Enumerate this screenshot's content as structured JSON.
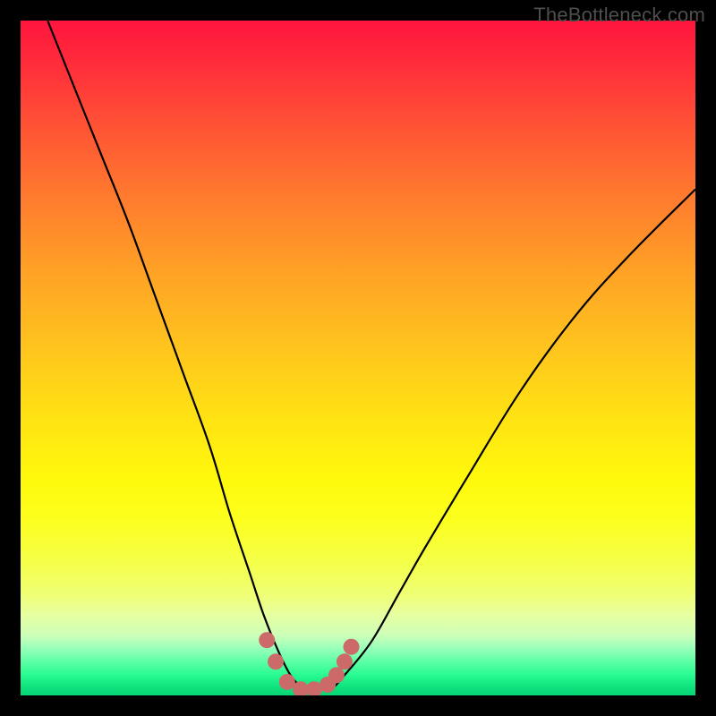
{
  "watermark": "TheBottleneck.com",
  "chart_data": {
    "type": "line",
    "title": "",
    "xlabel": "",
    "ylabel": "",
    "xlim": [
      0,
      100
    ],
    "ylim": [
      0,
      100
    ],
    "series": [
      {
        "name": "bottleneck-curve",
        "x": [
          4,
          8,
          12,
          16,
          20,
          24,
          28,
          31,
          34,
          36,
          38,
          40,
          42,
          44,
          46,
          48,
          52,
          56,
          60,
          66,
          74,
          82,
          90,
          100
        ],
        "y": [
          100,
          90,
          80,
          70,
          59,
          48,
          37,
          27,
          18,
          12,
          7,
          3,
          1,
          1,
          1,
          3,
          8,
          15,
          22,
          32,
          45,
          56,
          65,
          75
        ]
      }
    ],
    "markers": {
      "name": "trough-markers",
      "color": "#cb6a69",
      "x": [
        36.5,
        37.8,
        39.5,
        41.5,
        43.5,
        45.5,
        46.8,
        48.0,
        49.0
      ],
      "y": [
        8.2,
        5.0,
        2.0,
        0.9,
        0.9,
        1.6,
        3.0,
        5.0,
        7.2
      ]
    }
  }
}
